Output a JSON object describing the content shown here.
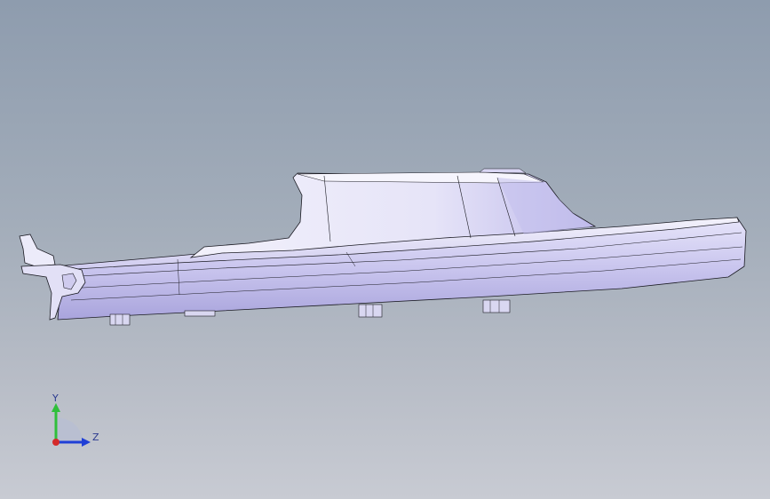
{
  "viewport": {
    "background_top": "#8e9cae",
    "background_bottom": "#c8cbd3"
  },
  "model": {
    "name": "part-model",
    "body_color": "#e9e8f8",
    "shadow_color": "#b9b6e3",
    "edge_color": "#1a1a22"
  },
  "triad": {
    "y_label": "Y",
    "z_label": "Z",
    "y_color": "#2fbf3a",
    "z_color": "#1f3fd6",
    "x_color": "#d42a2a"
  }
}
